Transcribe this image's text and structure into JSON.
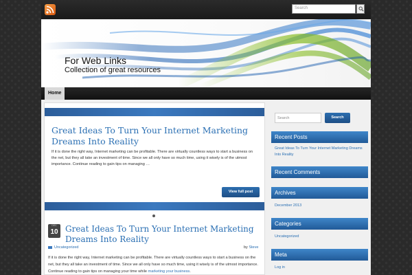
{
  "topbar": {
    "search_placeholder": "Search"
  },
  "header": {
    "site_title": "For Web Links",
    "site_description": "Collection of great resources"
  },
  "nav": {
    "items": [
      "Home"
    ]
  },
  "featured": {
    "title": "Great Ideas To Turn Your Internet Marketing Dreams Into Reality",
    "excerpt": "If it is done the right way, Internet marketing can be profitable. There are virtually countless ways to start a business on the net, but they all take an investment of time. Since we all only have so much time, using it wisely is of the utmost importance. Continue reading to gain tips on managing …",
    "button_label": "View full post"
  },
  "post": {
    "date_month": "DEC",
    "date_day": "10",
    "title": "Great Ideas To Turn Your Internet Marketing Dreams Into Reality",
    "category": "Uncategorized",
    "by_label": "by",
    "author": "Steve",
    "text_before_link": "If it is done the right way, Internet marketing can be profitable. There are virtually countless ways to start a business on the net, but they all take an investment of time. Since we all only have so much time, using it wisely is of the utmost importance. Continue reading to gain tips on managing your time while",
    "text_link": "marketing your business",
    "text_after_link": "."
  },
  "sidebar": {
    "search_placeholder": "Search",
    "search_button": "Search",
    "recent_posts_title": "Recent Posts",
    "recent_posts": [
      "Great Ideas To Turn Your Internet Marketing Dreams Into Reality"
    ],
    "recent_comments_title": "Recent Comments",
    "archives_title": "Archives",
    "archives": [
      "December 2013"
    ],
    "categories_title": "Categories",
    "categories": [
      "Uncategorized"
    ],
    "meta_title": "Meta",
    "meta": [
      "Log in"
    ]
  },
  "colors": {
    "accent_blue": "#2a6fb3",
    "widget_header": "#215a98",
    "rss_orange": "#f7a048"
  },
  "icons": [
    "rss-icon",
    "search-icon",
    "folder-icon"
  ]
}
